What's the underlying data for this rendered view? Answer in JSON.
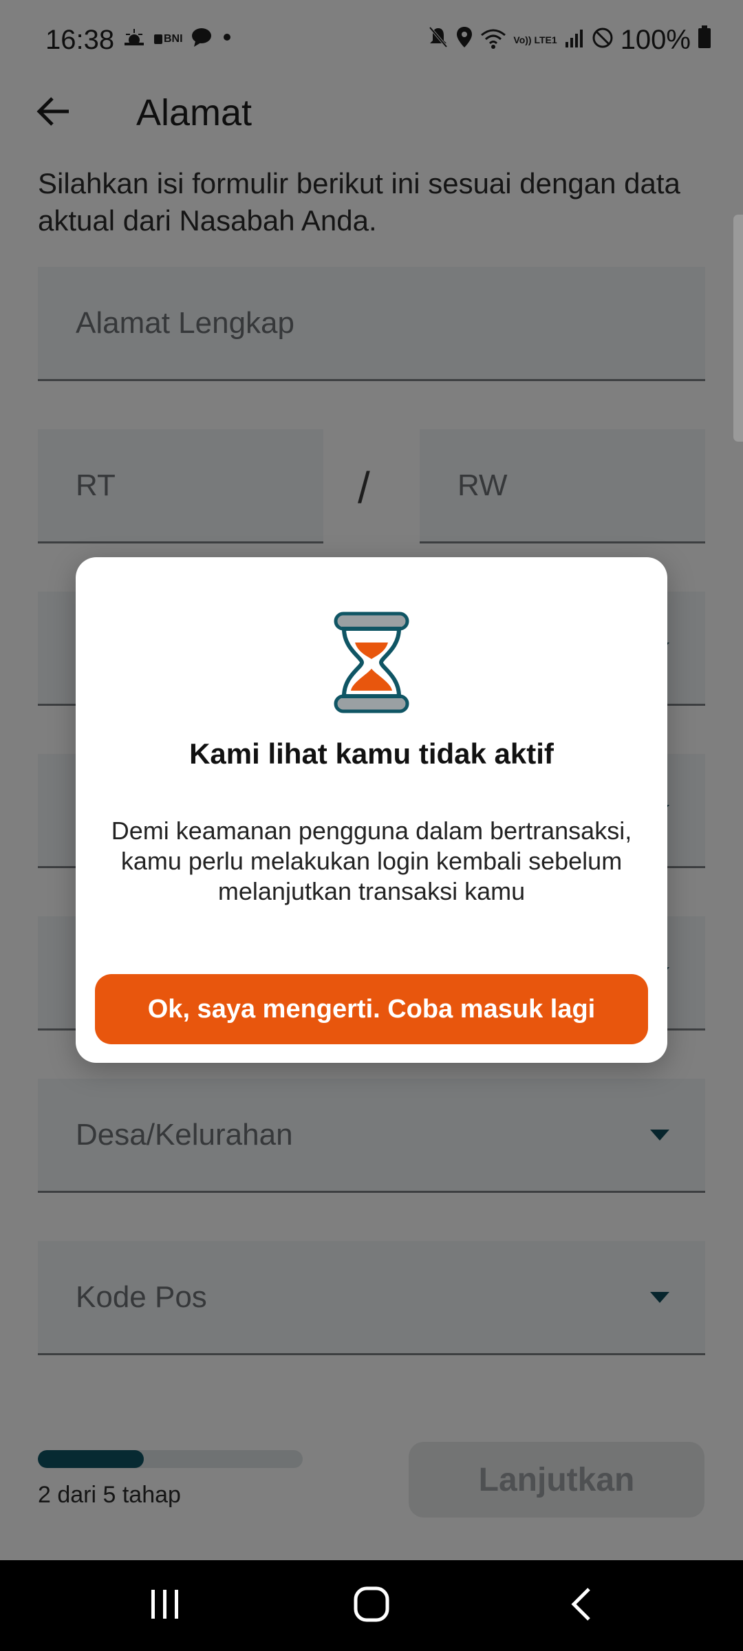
{
  "status_bar": {
    "time": "16:38",
    "left_icons": [
      "weather-icon",
      "bank-notification-icon",
      "chat-icon",
      "dot-icon"
    ],
    "bank_label": "BNI",
    "volte_label": "Vo)) LTE1",
    "battery": "100%",
    "right_icons": [
      "mute-icon",
      "location-icon",
      "wifi-icon",
      "signal-icon",
      "blocked-icon",
      "battery-icon"
    ]
  },
  "header": {
    "title": "Alamat",
    "back_icon": "arrow-left-icon"
  },
  "intro": {
    "text": "Silahkan isi formulir berikut ini sesuai dengan data aktual dari Nasabah Anda."
  },
  "form": {
    "address_label": "Alamat Lengkap",
    "rt_label": "RT",
    "separator": "/",
    "rw_label": "RW",
    "village_label": "Desa/Kelurahan",
    "postal_label": "Kode Pos"
  },
  "progress": {
    "text": "2 dari 5 tahap",
    "current_step": 2,
    "total_steps": 5,
    "fill_fraction": 0.4
  },
  "continue_button": {
    "label": "Lanjutkan"
  },
  "dialog": {
    "icon": "hourglass-icon",
    "title": "Kami lihat kamu tidak aktif",
    "body": "Demi keamanan pengguna dalam bertransaksi, kamu perlu melakukan login kembali sebelum melanjutkan transaksi kamu",
    "button_label": "Ok, saya mengerti. Coba masuk lagi"
  },
  "nav_bar": {
    "recents_icon": "recents-icon",
    "home_icon": "home-icon",
    "back_icon": "back-chevron-icon"
  },
  "colors": {
    "accent_orange": "#e8560d",
    "primary_teal": "#0f5564",
    "field_background": "#f0f4f6"
  }
}
